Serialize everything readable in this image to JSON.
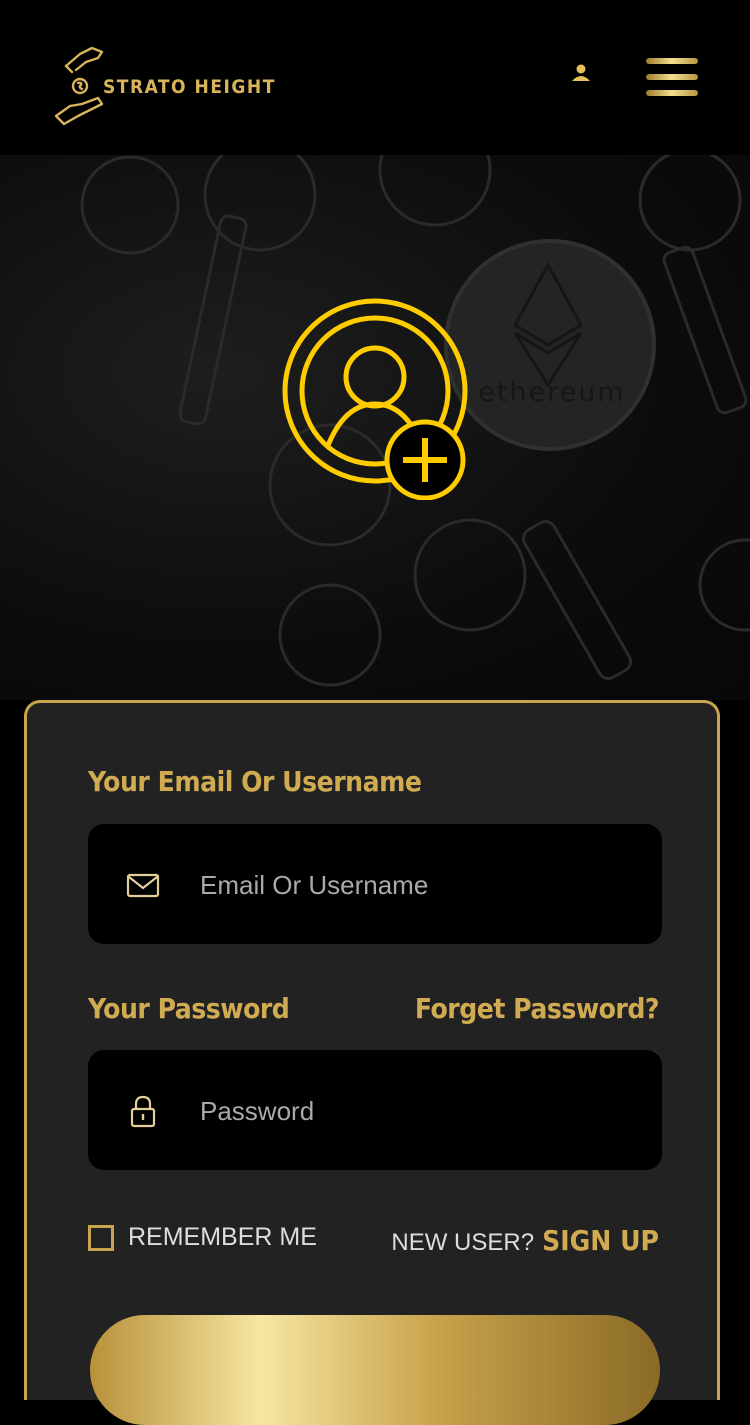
{
  "header": {
    "brand": "STRATO HEIGHT",
    "logo_icon": "hands-coin-icon",
    "user_icon": "user-icon",
    "menu_icon": "hamburger-menu-icon"
  },
  "hero": {
    "icon": "add-user-icon",
    "background_coin_text": "ethereum"
  },
  "form": {
    "email_label": "Your Email Or Username",
    "email_placeholder": "Email Or Username",
    "email_icon": "envelope-icon",
    "password_label": "Your Password",
    "forgot_link": "Forget Password?",
    "password_placeholder": "Password",
    "password_icon": "lock-icon",
    "remember_label": "REMEMBER ME",
    "new_user_text": "NEW USER?",
    "signup_link": "SIGN UP"
  },
  "colors": {
    "accent_gold": "#d1ab52",
    "icon_yellow": "#ffcc00",
    "background": "#000000",
    "card": "#222222"
  }
}
